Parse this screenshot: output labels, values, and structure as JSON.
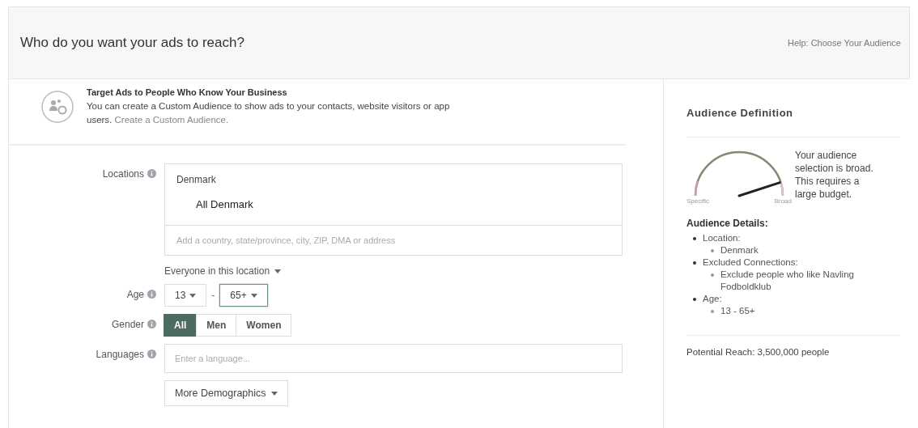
{
  "header": {
    "title": "Who do you want your ads to reach?",
    "help_link": "Help: Choose Your Audience"
  },
  "custom_audience": {
    "title": "Target Ads to People Who Know Your Business",
    "text": "You can create a Custom Audience to show ads to your contacts, website visitors or app users.",
    "link": "Create a Custom Audience."
  },
  "locations": {
    "label": "Locations",
    "country": "Denmark",
    "items": [
      "All Denmark"
    ],
    "placeholder": "Add a country, state/province, city, ZIP, DMA or address",
    "scope": "Everyone in this location"
  },
  "age": {
    "label": "Age",
    "separator": "-",
    "selects": [
      {
        "value": "13",
        "focused": false
      },
      {
        "value": "65+",
        "focused": true
      }
    ]
  },
  "gender": {
    "label": "Gender",
    "options": [
      {
        "label": "All",
        "selected": true
      },
      {
        "label": "Men",
        "selected": false
      },
      {
        "label": "Women",
        "selected": false
      }
    ]
  },
  "languages": {
    "label": "Languages",
    "placeholder": "Enter a language..."
  },
  "more_demographics": "More Demographics",
  "audience_definition": {
    "title": "Audience Definition",
    "gauge": {
      "level": 0.9,
      "min_label": "Specific",
      "max_label": "Broad"
    },
    "message": "Your audience selection is broad. This requires a large budget.",
    "details_title": "Audience Details:",
    "details": [
      {
        "label": "Location:",
        "children": [
          "Denmark"
        ]
      },
      {
        "label": "Excluded Connections:",
        "children": [
          "Exclude people who like Navling Fodboldklub"
        ]
      },
      {
        "label": "Age:",
        "children": [
          "13 - 65+"
        ]
      }
    ],
    "potential_reach": "Potential Reach: 3,500,000 people"
  }
}
